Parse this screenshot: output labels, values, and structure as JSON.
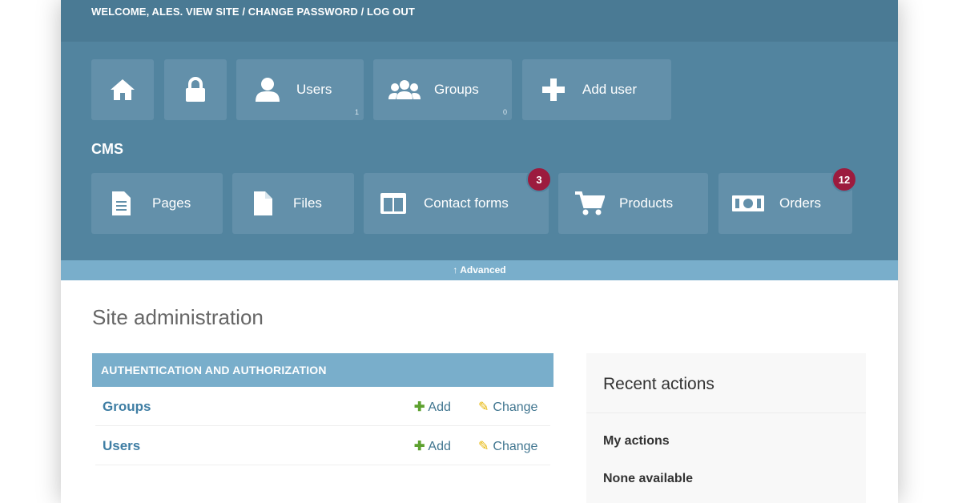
{
  "topbar": {
    "welcome": "WELCOME,",
    "user": "ALES.",
    "links": "VIEW SITE / CHANGE PASSWORD / LOG OUT"
  },
  "auth_tiles": [
    {
      "label": "",
      "icon": "home-icon"
    },
    {
      "label": "",
      "icon": "lock-icon"
    },
    {
      "label": "Users",
      "icon": "user-icon",
      "count": "1"
    },
    {
      "label": "Groups",
      "icon": "users-icon",
      "count": "0"
    },
    {
      "label": "Add user",
      "icon": "plus-icon"
    }
  ],
  "cms": {
    "label": "CMS",
    "tiles": [
      {
        "label": "Pages",
        "icon": "page-icon"
      },
      {
        "label": "Files",
        "icon": "file-icon"
      },
      {
        "label": "Contact forms",
        "icon": "columns-icon",
        "badge": "3"
      },
      {
        "label": "Products",
        "icon": "cart-icon"
      },
      {
        "label": "Orders",
        "icon": "money-icon",
        "badge": "12"
      }
    ]
  },
  "advanced": "↑ Advanced",
  "main": {
    "title": "Site administration",
    "module": {
      "header": "AUTHENTICATION AND AUTHORIZATION",
      "rows": [
        {
          "name": "Groups",
          "add": "Add",
          "change": "Change"
        },
        {
          "name": "Users",
          "add": "Add",
          "change": "Change"
        }
      ]
    },
    "recent": {
      "title": "Recent actions",
      "subtitle": "My actions",
      "empty": "None available"
    }
  },
  "colors": {
    "header_bg": "#52849f",
    "tile_bg": "#6390aa",
    "accent": "#79aecb",
    "badge": "#9c1b3e"
  }
}
